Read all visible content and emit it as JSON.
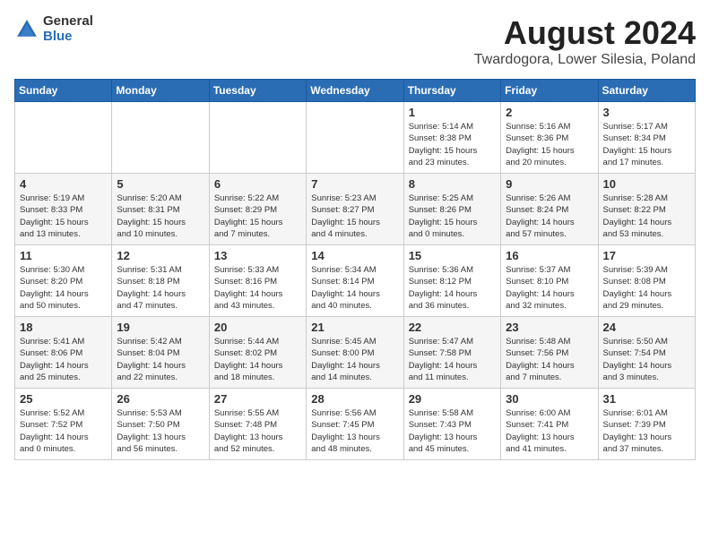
{
  "header": {
    "logo_general": "General",
    "logo_blue": "Blue",
    "main_title": "August 2024",
    "subtitle": "Twardogora, Lower Silesia, Poland"
  },
  "calendar": {
    "days_of_week": [
      "Sunday",
      "Monday",
      "Tuesday",
      "Wednesday",
      "Thursday",
      "Friday",
      "Saturday"
    ],
    "weeks": [
      [
        {
          "day": "",
          "info": ""
        },
        {
          "day": "",
          "info": ""
        },
        {
          "day": "",
          "info": ""
        },
        {
          "day": "",
          "info": ""
        },
        {
          "day": "1",
          "info": "Sunrise: 5:14 AM\nSunset: 8:38 PM\nDaylight: 15 hours\nand 23 minutes."
        },
        {
          "day": "2",
          "info": "Sunrise: 5:16 AM\nSunset: 8:36 PM\nDaylight: 15 hours\nand 20 minutes."
        },
        {
          "day": "3",
          "info": "Sunrise: 5:17 AM\nSunset: 8:34 PM\nDaylight: 15 hours\nand 17 minutes."
        }
      ],
      [
        {
          "day": "4",
          "info": "Sunrise: 5:19 AM\nSunset: 8:33 PM\nDaylight: 15 hours\nand 13 minutes."
        },
        {
          "day": "5",
          "info": "Sunrise: 5:20 AM\nSunset: 8:31 PM\nDaylight: 15 hours\nand 10 minutes."
        },
        {
          "day": "6",
          "info": "Sunrise: 5:22 AM\nSunset: 8:29 PM\nDaylight: 15 hours\nand 7 minutes."
        },
        {
          "day": "7",
          "info": "Sunrise: 5:23 AM\nSunset: 8:27 PM\nDaylight: 15 hours\nand 4 minutes."
        },
        {
          "day": "8",
          "info": "Sunrise: 5:25 AM\nSunset: 8:26 PM\nDaylight: 15 hours\nand 0 minutes."
        },
        {
          "day": "9",
          "info": "Sunrise: 5:26 AM\nSunset: 8:24 PM\nDaylight: 14 hours\nand 57 minutes."
        },
        {
          "day": "10",
          "info": "Sunrise: 5:28 AM\nSunset: 8:22 PM\nDaylight: 14 hours\nand 53 minutes."
        }
      ],
      [
        {
          "day": "11",
          "info": "Sunrise: 5:30 AM\nSunset: 8:20 PM\nDaylight: 14 hours\nand 50 minutes."
        },
        {
          "day": "12",
          "info": "Sunrise: 5:31 AM\nSunset: 8:18 PM\nDaylight: 14 hours\nand 47 minutes."
        },
        {
          "day": "13",
          "info": "Sunrise: 5:33 AM\nSunset: 8:16 PM\nDaylight: 14 hours\nand 43 minutes."
        },
        {
          "day": "14",
          "info": "Sunrise: 5:34 AM\nSunset: 8:14 PM\nDaylight: 14 hours\nand 40 minutes."
        },
        {
          "day": "15",
          "info": "Sunrise: 5:36 AM\nSunset: 8:12 PM\nDaylight: 14 hours\nand 36 minutes."
        },
        {
          "day": "16",
          "info": "Sunrise: 5:37 AM\nSunset: 8:10 PM\nDaylight: 14 hours\nand 32 minutes."
        },
        {
          "day": "17",
          "info": "Sunrise: 5:39 AM\nSunset: 8:08 PM\nDaylight: 14 hours\nand 29 minutes."
        }
      ],
      [
        {
          "day": "18",
          "info": "Sunrise: 5:41 AM\nSunset: 8:06 PM\nDaylight: 14 hours\nand 25 minutes."
        },
        {
          "day": "19",
          "info": "Sunrise: 5:42 AM\nSunset: 8:04 PM\nDaylight: 14 hours\nand 22 minutes."
        },
        {
          "day": "20",
          "info": "Sunrise: 5:44 AM\nSunset: 8:02 PM\nDaylight: 14 hours\nand 18 minutes."
        },
        {
          "day": "21",
          "info": "Sunrise: 5:45 AM\nSunset: 8:00 PM\nDaylight: 14 hours\nand 14 minutes."
        },
        {
          "day": "22",
          "info": "Sunrise: 5:47 AM\nSunset: 7:58 PM\nDaylight: 14 hours\nand 11 minutes."
        },
        {
          "day": "23",
          "info": "Sunrise: 5:48 AM\nSunset: 7:56 PM\nDaylight: 14 hours\nand 7 minutes."
        },
        {
          "day": "24",
          "info": "Sunrise: 5:50 AM\nSunset: 7:54 PM\nDaylight: 14 hours\nand 3 minutes."
        }
      ],
      [
        {
          "day": "25",
          "info": "Sunrise: 5:52 AM\nSunset: 7:52 PM\nDaylight: 14 hours\nand 0 minutes."
        },
        {
          "day": "26",
          "info": "Sunrise: 5:53 AM\nSunset: 7:50 PM\nDaylight: 13 hours\nand 56 minutes."
        },
        {
          "day": "27",
          "info": "Sunrise: 5:55 AM\nSunset: 7:48 PM\nDaylight: 13 hours\nand 52 minutes."
        },
        {
          "day": "28",
          "info": "Sunrise: 5:56 AM\nSunset: 7:45 PM\nDaylight: 13 hours\nand 48 minutes."
        },
        {
          "day": "29",
          "info": "Sunrise: 5:58 AM\nSunset: 7:43 PM\nDaylight: 13 hours\nand 45 minutes."
        },
        {
          "day": "30",
          "info": "Sunrise: 6:00 AM\nSunset: 7:41 PM\nDaylight: 13 hours\nand 41 minutes."
        },
        {
          "day": "31",
          "info": "Sunrise: 6:01 AM\nSunset: 7:39 PM\nDaylight: 13 hours\nand 37 minutes."
        }
      ]
    ]
  }
}
